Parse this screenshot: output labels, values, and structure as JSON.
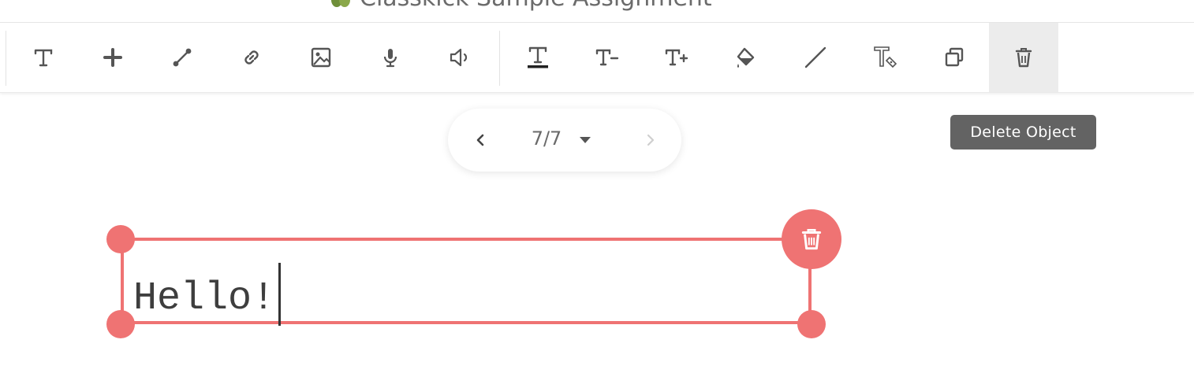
{
  "header": {
    "title": "Classkick Sample Assignment",
    "icon": "leaf-icon"
  },
  "toolbar": {
    "tools": [
      {
        "name": "text-tool",
        "icon": "text-icon"
      },
      {
        "name": "add-tool",
        "icon": "plus-icon"
      },
      {
        "name": "line-tool",
        "icon": "line-segment-icon"
      },
      {
        "name": "link-tool",
        "icon": "link-icon"
      },
      {
        "name": "image-tool",
        "icon": "image-icon"
      },
      {
        "name": "record-tool",
        "icon": "microphone-icon"
      },
      {
        "name": "audio-tool",
        "icon": "speaker-icon"
      },
      {
        "name": "text-color-tool",
        "icon": "text-underline-icon"
      },
      {
        "name": "text-smaller-tool",
        "icon": "text-minus-icon"
      },
      {
        "name": "text-larger-tool",
        "icon": "text-plus-icon"
      },
      {
        "name": "fill-tool",
        "icon": "paint-bucket-icon"
      },
      {
        "name": "stroke-tool",
        "icon": "slash-line-icon"
      },
      {
        "name": "font-style-tool",
        "icon": "text-style-icon"
      },
      {
        "name": "duplicate-tool",
        "icon": "duplicate-icon"
      },
      {
        "name": "delete-tool",
        "icon": "trash-icon"
      }
    ]
  },
  "pager": {
    "current": "7/7"
  },
  "tooltip": {
    "label": "Delete Object"
  },
  "canvas": {
    "text_value": "Hello!"
  },
  "colors": {
    "accent": "#ef7373",
    "icon": "#555555",
    "tooltip_bg": "#636363"
  }
}
